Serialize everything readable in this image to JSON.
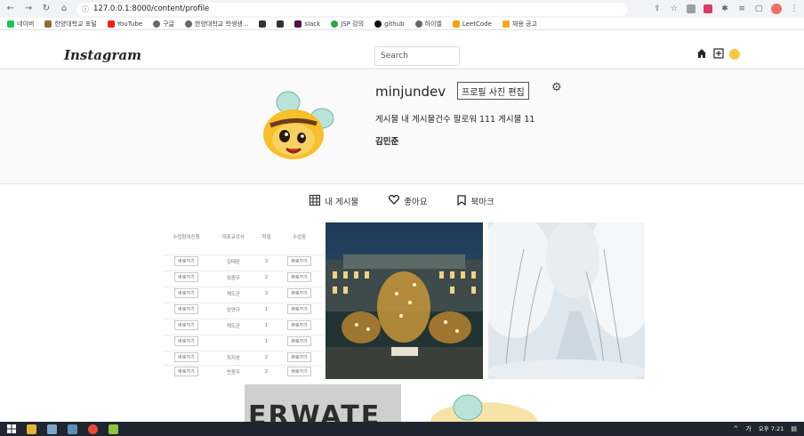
{
  "browser": {
    "url": "127.0.0.1:8000/content/profile",
    "bookmarks": [
      "네이버",
      "한양대학교 포털",
      "YouTube",
      "구글",
      "한양대학교 학생생...",
      "slack",
      "JSP 강의",
      "github",
      "하이엘",
      "LeetCode",
      "채용 공고"
    ]
  },
  "nav": {
    "logo": "Instagram",
    "search_placeholder": "Search"
  },
  "profile": {
    "username": "minjundev",
    "edit_label": "프로필 사진 편집",
    "stats": "게시물 내 게시물건수 팔로워 111 게시물 11",
    "fullname": "김민준"
  },
  "tabs": [
    {
      "label": "내 게시물",
      "icon": "grid-icon"
    },
    {
      "label": "좋아요",
      "icon": "heart-icon"
    },
    {
      "label": "북마크",
      "icon": "bookmark-icon"
    }
  ],
  "table_post": {
    "headers": [
      "수업참여신청",
      "대표교강사",
      "학점",
      "수업중"
    ],
    "button_label": "바로가기",
    "rows": [
      [
        "김태완",
        "3"
      ],
      [
        "임종우",
        "2"
      ],
      [
        "채도균",
        "3"
      ],
      [
        "임영규",
        "1"
      ],
      [
        "채도균",
        "1"
      ],
      [
        "",
        "1"
      ],
      [
        "최지상",
        "2"
      ],
      [
        "반종우",
        "2"
      ]
    ]
  },
  "water_post_text": "ERWATE",
  "taskbar": {
    "time": "오후 7:21",
    "ime": "가"
  },
  "colors": {
    "border": "#dbdbdb",
    "profile_bg": "#fafafa",
    "taskbar": "#1f2630"
  }
}
